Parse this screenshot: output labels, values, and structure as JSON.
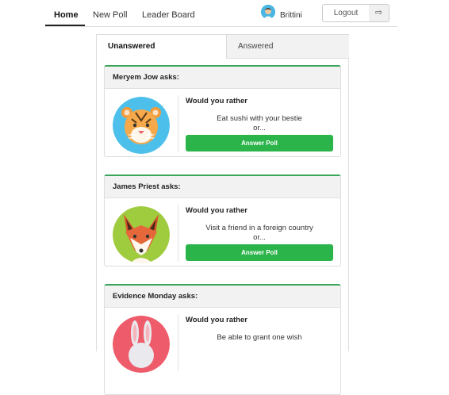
{
  "nav": {
    "links": [
      "Home",
      "New Poll",
      "Leader Board"
    ],
    "user_name": "Brittini",
    "logout_label": "Logout",
    "logout_icon": "sign-out-icon"
  },
  "tabs": [
    "Unanswered",
    "Answered"
  ],
  "questions": [
    {
      "author_line": "Meryem Jow asks:",
      "prompt": "Would you rather",
      "option": "Eat sushi with your bestie",
      "or_text": "or...",
      "button": "Answer Poll",
      "avatar": "tiger-avatar"
    },
    {
      "author_line": "James Priest asks:",
      "prompt": "Would you rather",
      "option": "Visit a friend in a foreign country",
      "or_text": "or...",
      "button": "Answer Poll",
      "avatar": "fox-avatar"
    },
    {
      "author_line": "Evidence Monday asks:",
      "prompt": "Would you rather",
      "option": "Be able to grant one wish",
      "or_text": "",
      "button": "",
      "avatar": "rabbit-avatar"
    }
  ],
  "colors": {
    "accent": "#2bb44a",
    "card_border_top": "#3aa55a"
  }
}
